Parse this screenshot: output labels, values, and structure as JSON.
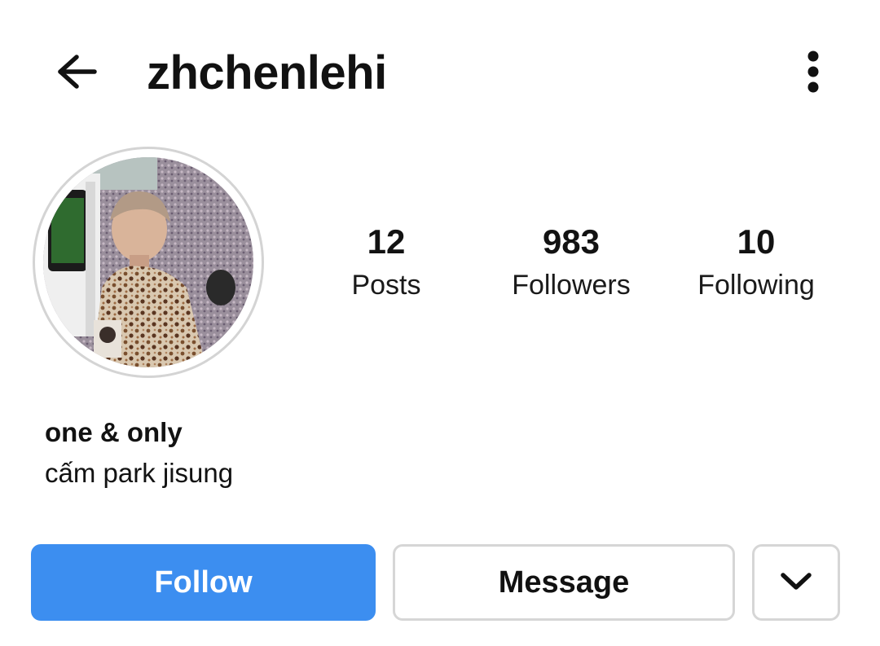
{
  "header": {
    "back_icon": "arrow-left-icon",
    "username": "zhchenlehi",
    "more_icon": "vertical-dots-icon"
  },
  "profile": {
    "avatar_icon": "profile-photo",
    "stats": [
      {
        "count": "12",
        "label": "Posts"
      },
      {
        "count": "983",
        "label": "Followers"
      },
      {
        "count": "10",
        "label": "Following"
      }
    ],
    "bio_name": "one & only",
    "bio_text": "cấm park jisung"
  },
  "actions": {
    "follow_label": "Follow",
    "message_label": "Message",
    "more_icon": "chevron-down-icon"
  },
  "colors": {
    "follow_bg": "#3c8ef0",
    "button_border": "#d6d6d6",
    "text": "#111111"
  }
}
